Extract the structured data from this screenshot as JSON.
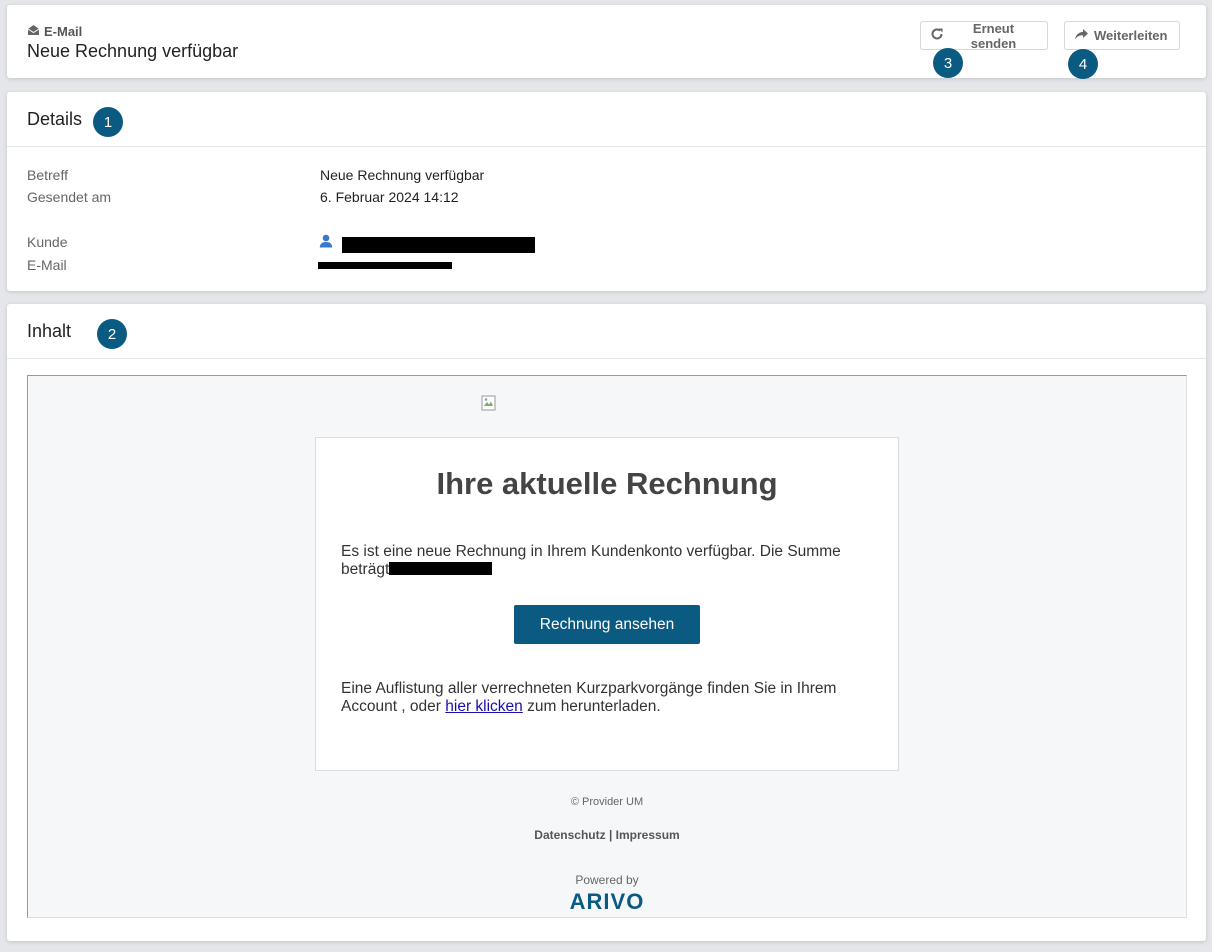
{
  "header": {
    "type_label": "E-Mail",
    "title": "Neue Rechnung verfügbar",
    "resend_label": "Erneut senden",
    "forward_label": "Weiterleiten",
    "resend_badge": "3",
    "forward_badge": "4"
  },
  "details": {
    "title": "Details",
    "badge": "1",
    "subject_label": "Betreff",
    "subject_value": "Neue Rechnung verfügbar",
    "sent_label": "Gesendet am",
    "sent_value": "6. Februar 2024 14:12",
    "customer_label": "Kunde",
    "email_label": "E-Mail"
  },
  "content": {
    "title": "Inhalt",
    "badge": "2",
    "mail": {
      "heading": "Ihre aktuelle Rechnung",
      "paragraph1": "Es ist eine neue Rechnung in Ihrem Kundenkonto verfügbar. Die Summe beträgt",
      "button_label": "Rechnung ansehen",
      "paragraph2_before": "Eine Auflistung aller verrechneten Kurzparkvorgänge finden Sie in Ihrem Account , oder ",
      "paragraph2_link": "hier klicken",
      "paragraph2_after": " zum herunterladen.",
      "copyright": "© Provider UM",
      "footer_privacy": "Datenschutz",
      "footer_separator": "|",
      "footer_imprint": "Impressum",
      "powered_by": "Powered by",
      "brand": "ARIVO"
    }
  },
  "colors": {
    "accent": "#0b5a82",
    "background": "#e4e6ea",
    "link": "#1a0dab"
  },
  "icons": {
    "type": "envelope-icon",
    "resend": "refresh-icon",
    "forward": "share-icon",
    "customer": "user-icon",
    "broken_image": "broken-image-icon"
  }
}
